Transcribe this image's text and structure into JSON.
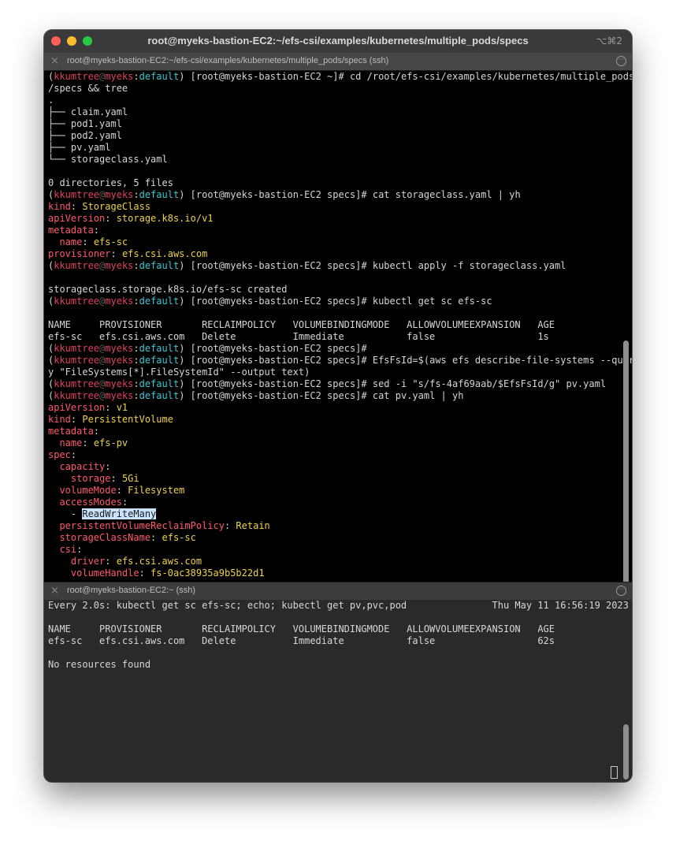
{
  "window": {
    "title": "root@myeks-bastion-EC2:~/efs-csi/examples/kubernetes/multiple_pods/specs",
    "shortcut": "⌥⌘2",
    "close_icon": "×"
  },
  "pane_top": {
    "title": "root@myeks-bastion-EC2:~/efs-csi/examples/kubernetes/multiple_pods/specs (ssh)"
  },
  "pane_bottom": {
    "title": "root@myeks-bastion-EC2:~ (ssh)"
  },
  "prompt": {
    "user": "kkumtree",
    "at": "@",
    "host": "myeks",
    "colon": ":",
    "ns": "default",
    "rest_home": ") [root@myeks-bastion-EC2 ~]# ",
    "rest_specs": ") [root@myeks-bastion-EC2 specs]# "
  },
  "top_lines": [
    {
      "type": "prompt_home",
      "cmd": "cd /root/efs-csi/examples/kubernetes/multiple_pods"
    },
    {
      "type": "plain",
      "text": "/specs && tree"
    },
    {
      "type": "plain",
      "text": "."
    },
    {
      "type": "plain",
      "text": "├── claim.yaml"
    },
    {
      "type": "plain",
      "text": "├── pod1.yaml"
    },
    {
      "type": "plain",
      "text": "├── pod2.yaml"
    },
    {
      "type": "plain",
      "text": "├── pv.yaml"
    },
    {
      "type": "plain",
      "text": "└── storageclass.yaml"
    },
    {
      "type": "plain",
      "text": ""
    },
    {
      "type": "plain",
      "text": "0 directories, 5 files"
    },
    {
      "type": "prompt",
      "cmd": "cat storageclass.yaml | yh"
    },
    {
      "type": "kv",
      "key": "kind",
      "value": "StorageClass"
    },
    {
      "type": "kv",
      "key": "apiVersion",
      "value": "storage.k8s.io/v1"
    },
    {
      "type": "kv",
      "key": "metadata",
      "value": ""
    },
    {
      "type": "kv",
      "indent": "  ",
      "key": "name",
      "value": "efs-sc"
    },
    {
      "type": "kv",
      "key": "provisioner",
      "value": "efs.csi.aws.com"
    },
    {
      "type": "prompt",
      "cmd": "kubectl apply -f storageclass.yaml"
    },
    {
      "type": "plain",
      "text": ""
    },
    {
      "type": "plain",
      "text": "storageclass.storage.k8s.io/efs-sc created"
    },
    {
      "type": "prompt",
      "cmd": "kubectl get sc efs-sc"
    },
    {
      "type": "plain",
      "text": ""
    },
    {
      "type": "plain",
      "text": "NAME     PROVISIONER       RECLAIMPOLICY   VOLUMEBINDINGMODE   ALLOWVOLUMEEXPANSION   AGE"
    },
    {
      "type": "plain",
      "text": "efs-sc   efs.csi.aws.com   Delete          Immediate           false                  1s"
    },
    {
      "type": "prompt",
      "cmd": ""
    },
    {
      "type": "prompt",
      "cmd": "EfsFsId=$(aws efs describe-file-systems --quer"
    },
    {
      "type": "plain",
      "text": "y \"FileSystems[*].FileSystemId\" --output text)"
    },
    {
      "type": "prompt",
      "cmd": "sed -i \"s/fs-4af69aab/$EfsFsId/g\" pv.yaml"
    },
    {
      "type": "prompt",
      "cmd": "cat pv.yaml | yh"
    },
    {
      "type": "kv",
      "key": "apiVersion",
      "value": "v1"
    },
    {
      "type": "kv",
      "key": "kind",
      "value": "PersistentVolume"
    },
    {
      "type": "kv",
      "key": "metadata",
      "value": ""
    },
    {
      "type": "kv",
      "indent": "  ",
      "key": "name",
      "value": "efs-pv"
    },
    {
      "type": "kv",
      "key": "spec",
      "value": ""
    },
    {
      "type": "kv",
      "indent": "  ",
      "key": "capacity",
      "value": ""
    },
    {
      "type": "kv",
      "indent": "    ",
      "key": "storage",
      "value": "5Gi"
    },
    {
      "type": "kv",
      "indent": "  ",
      "key": "volumeMode",
      "value": "Filesystem"
    },
    {
      "type": "kv",
      "indent": "  ",
      "key": "accessModes",
      "value": ""
    },
    {
      "type": "listsel",
      "indent": "    ",
      "dash": "- ",
      "value": "ReadWriteMany"
    },
    {
      "type": "kv",
      "indent": "  ",
      "key": "persistentVolumeReclaimPolicy",
      "value": "Retain"
    },
    {
      "type": "kv",
      "indent": "  ",
      "key": "storageClassName",
      "value": "efs-sc"
    },
    {
      "type": "kv",
      "indent": "  ",
      "key": "csi",
      "value": ""
    },
    {
      "type": "kv",
      "indent": "    ",
      "key": "driver",
      "value": "efs.csi.aws.com"
    },
    {
      "type": "kv",
      "indent": "    ",
      "key": "volumeHandle",
      "value": "fs-0ac38935a9b5b22d1"
    }
  ],
  "bottom_lines": [
    {
      "type": "plain",
      "text": "Every 2.0s: kubectl get sc efs-sc; echo; kubectl get pv,pvc,pod               Thu May 11 16:56:19 2023"
    },
    {
      "type": "plain",
      "text": ""
    },
    {
      "type": "plain",
      "text": "NAME     PROVISIONER       RECLAIMPOLICY   VOLUMEBINDINGMODE   ALLOWVOLUMEEXPANSION   AGE"
    },
    {
      "type": "plain",
      "text": "efs-sc   efs.csi.aws.com   Delete          Immediate           false                  62s"
    },
    {
      "type": "plain",
      "text": ""
    },
    {
      "type": "plain",
      "text": "No resources found"
    }
  ]
}
